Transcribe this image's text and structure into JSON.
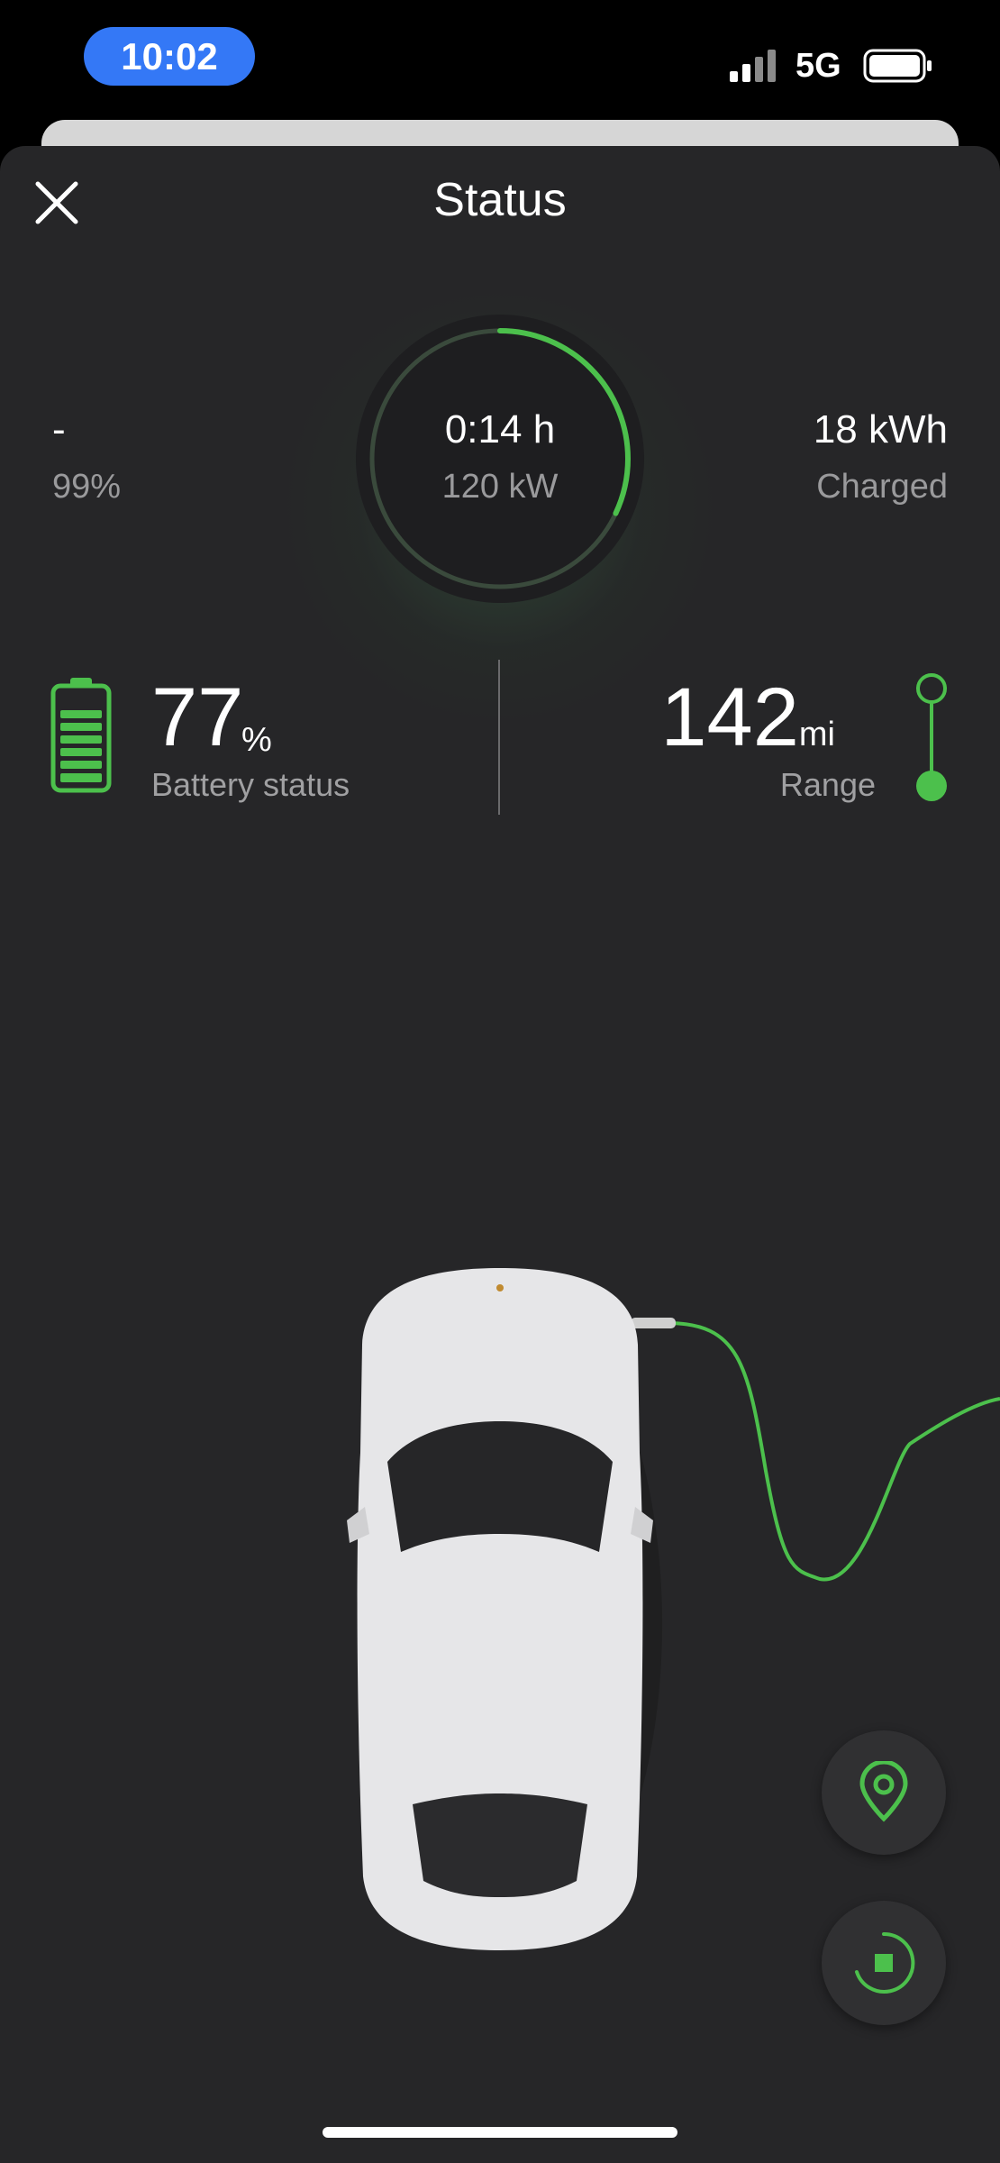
{
  "status_bar": {
    "time": "10:02",
    "network": "5G"
  },
  "header": {
    "title": "Status"
  },
  "charging": {
    "time_remaining": "0:14 h",
    "power": "120 kW",
    "ring_progress_fraction": 0.32,
    "target_value": "-",
    "target_soc": "99%",
    "energy_value": "18 kWh",
    "energy_label": "Charged"
  },
  "battery": {
    "value": "77",
    "unit": "%",
    "label": "Battery status"
  },
  "range": {
    "value": "142",
    "unit": "mi",
    "label": "Range"
  },
  "colors": {
    "accent": "#4cc04c",
    "background": "#262628",
    "secondary_text": "#9a9a9c"
  },
  "icons": {
    "close": "close-icon",
    "location": "location-pin-icon",
    "stop": "stop-charging-icon"
  }
}
